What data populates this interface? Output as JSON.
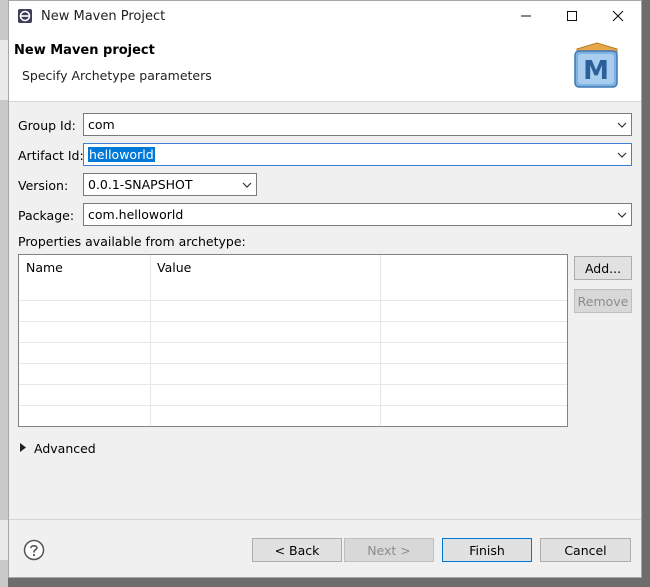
{
  "window": {
    "title": "New Maven Project"
  },
  "header": {
    "title": "New Maven project",
    "subtitle": "Specify Archetype parameters",
    "logo_letter": "M"
  },
  "form": {
    "group_id": {
      "label": "Group Id:",
      "value": "com"
    },
    "artifact_id": {
      "label": "Artifact Id:",
      "value": "helloworld"
    },
    "version": {
      "label": "Version:",
      "value": "0.0.1-SNAPSHOT"
    },
    "package": {
      "label": "Package:",
      "value": "com.helloworld"
    }
  },
  "properties": {
    "label": "Properties available from archetype:",
    "columns": [
      "Name",
      "Value"
    ],
    "rows": [],
    "add_label": "Add...",
    "remove_label": "Remove"
  },
  "advanced": {
    "label": "Advanced"
  },
  "footer": {
    "back_label": "< Back",
    "next_label": "Next >",
    "finish_label": "Finish",
    "cancel_label": "Cancel"
  },
  "colors": {
    "selection": "#0078d7",
    "focus_border": "#3c7fd6",
    "dialog_bg": "#f0f0f0"
  }
}
